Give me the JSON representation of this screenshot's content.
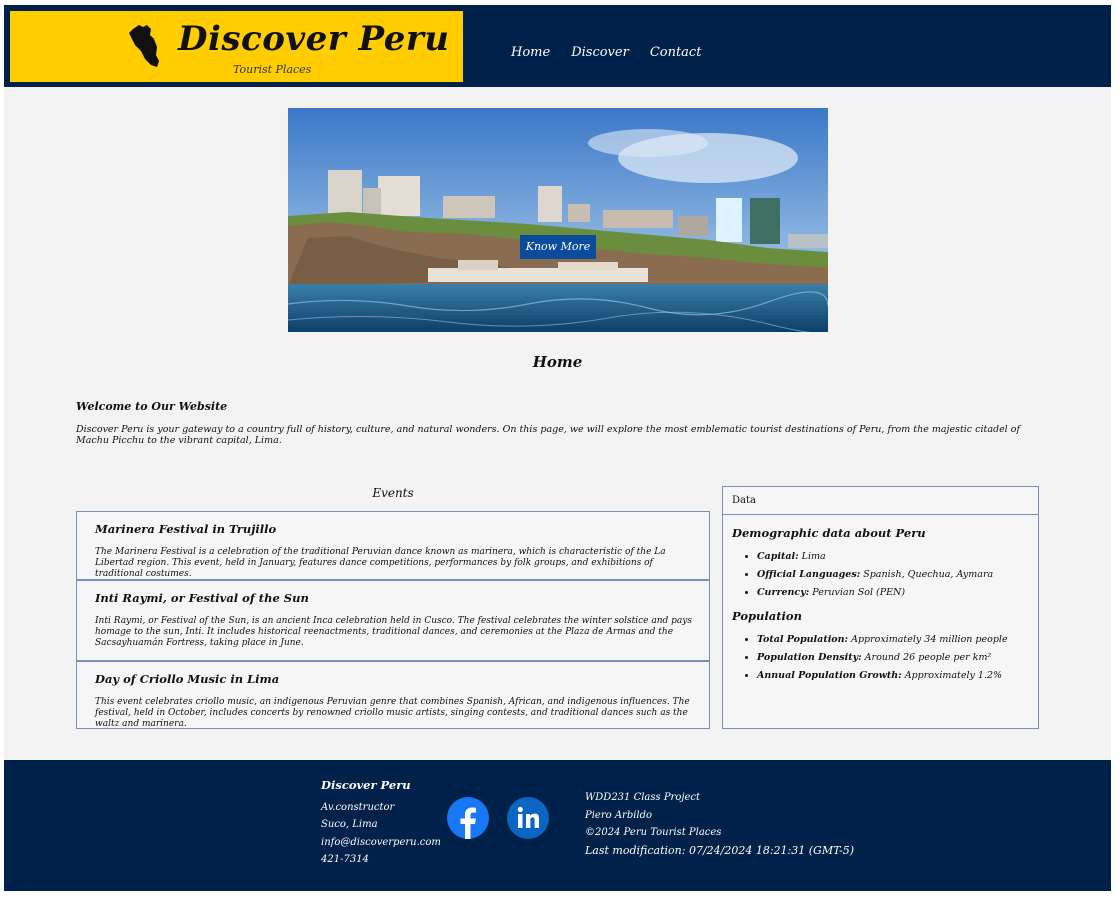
{
  "header": {
    "title": "Discover Peru",
    "subtitle": "Tourist Places",
    "nav": [
      "Home",
      "Discover",
      "Contact"
    ]
  },
  "hero": {
    "button_label": "Know More"
  },
  "main": {
    "page_title": "Home",
    "welcome_heading": "Welcome to Our Website",
    "welcome_text": "Discover Peru is your gateway to a country full of history, culture, and natural wonders. On this page, we will explore the most emblematic tourist destinations of Peru, from the majestic citadel of Machu Picchu to the vibrant capital, Lima."
  },
  "events": {
    "heading": "Events",
    "items": [
      {
        "title": "Marinera Festival in Trujillo",
        "text": "The Marinera Festival is a celebration of the traditional Peruvian dance known as marinera, which is characteristic of the La Libertad region. This event, held in January, features dance competitions, performances by folk groups, and exhibitions of traditional costumes."
      },
      {
        "title": "Inti Raymi, or Festival of the Sun",
        "text": "Inti Raymi, or Festival of the Sun, is an ancient Inca celebration held in Cusco. The festival celebrates the winter solstice and pays homage to the sun, Inti. It includes historical reenactments, traditional dances, and ceremonies at the Plaza de Armas and the Sacsayhuamán Fortress, taking place in June."
      },
      {
        "title": "Day of Criollo Music in Lima",
        "text": "This event celebrates criollo music, an indigenous Peruvian genre that combines Spanish, African, and indigenous influences. The festival, held in October, includes concerts by renowned criollo music artists, singing contests, and traditional dances such as the waltz and marinera."
      }
    ]
  },
  "data_box": {
    "label": "Data",
    "demographic_heading": "Demographic data about Peru",
    "demographic": [
      {
        "k": "Capital:",
        "v": " Lima"
      },
      {
        "k": "Official Languages:",
        "v": " Spanish, Quechua, Aymara"
      },
      {
        "k": "Currency:",
        "v": " Peruvian Sol (PEN)"
      }
    ],
    "population_heading": "Population",
    "population": [
      {
        "k": "Total Population:",
        "v": " Approximately 34 million people"
      },
      {
        "k": "Population Density:",
        "v": " Around 26 people per km²"
      },
      {
        "k": "Annual Population Growth:",
        "v": " Approximately 1.2%"
      }
    ]
  },
  "footer": {
    "brand": "Discover Peru",
    "address1": "Av.constructor",
    "address2": "Suco, Lima",
    "email": "info@discoverperu.com",
    "phone": "421-7314",
    "class_project": "WDD231 Class Project",
    "author": "Piero Arbildo",
    "copyright": "©2024 Peru Tourist Places",
    "last_modified": "Last modification: 07/24/2024 18:21:31 (GMT-5)"
  },
  "colors": {
    "navy": "#00214a",
    "logo_yellow": "#ffcd00",
    "button_blue": "#0a4c9c",
    "facebook_blue": "#1877f2",
    "linkedin_blue": "#0a66c2"
  },
  "icons": [
    "peru-map-icon",
    "facebook-icon",
    "linkedin-icon"
  ]
}
